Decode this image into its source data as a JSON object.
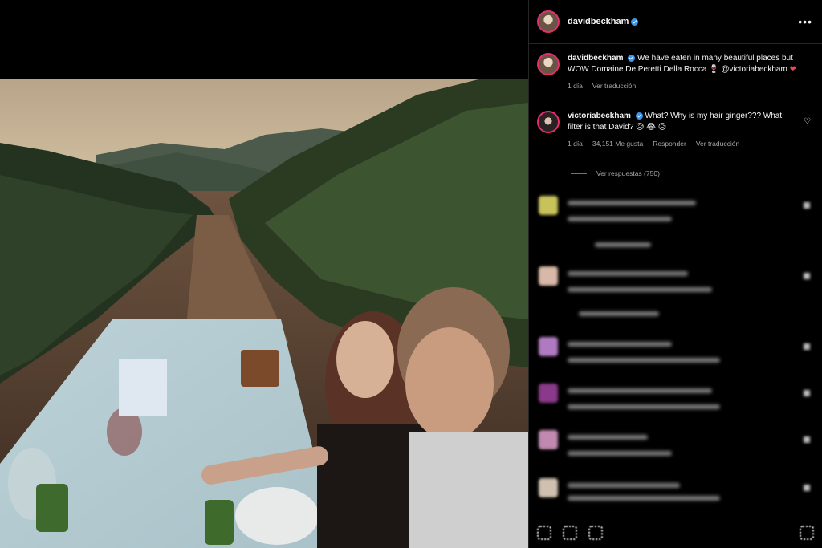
{
  "post": {
    "username": "davidbeckham"
  },
  "caption": {
    "username": "davidbeckham",
    "text": "We have eaten in many beautiful places but WOW Domaine De Peretti Della Rocca",
    "mention": "@victoriabeckham",
    "time": "1 día",
    "translate": "Ver traducción"
  },
  "top_comment": {
    "username": "victoriabeckham",
    "text": "What? Why is my hair ginger??? What filter is that David? 😥 😂 😥",
    "time": "1 día",
    "likes": "34,151 Me gusta",
    "reply": "Responder",
    "translate": "Ver traducción",
    "view_replies": "Ver respuestas (750)"
  },
  "colors": {
    "background": "#000000",
    "verified": "#3897f0",
    "heart": "#ed4956",
    "muted_text": "#a8a8a8"
  }
}
